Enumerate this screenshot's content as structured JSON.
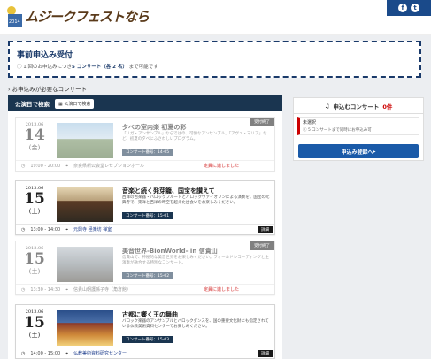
{
  "header": {
    "logo_text": "ムジークフェストなら",
    "logo_year": "2014"
  },
  "notice": {
    "title": "事前申込み受付",
    "prefix": "1 回のお申込みにつき",
    "bold": "5 コンサート（各 2 名）",
    "suffix": "まで可能です"
  },
  "section_label": "お申込みが必要なコンサート",
  "list": {
    "title": "公演日で検索",
    "search_btn": "公演日で検索"
  },
  "concerts": [
    {
      "year": "2013.06",
      "day": "14",
      "weekday": "(金)",
      "title": "夕べの室内楽 初夏の彩",
      "desc": "「リガ・アンサンブル」ならではの、可憐なアンサンブル。「アヴェ・マリア」など、初夏の夕べにふさわしいプログラム。",
      "tag": "コンサート番号：14-05",
      "time": "19:00 - 20:00",
      "venue": "奈良県新公会堂レセプションホール",
      "status": "受付終了",
      "end": "定員に達しました",
      "detail": ""
    },
    {
      "year": "2013.06",
      "day": "15",
      "weekday": "(土)",
      "title": "音楽と続く発芽籠、国宝を讃えて",
      "desc": "西洋の古楽器・バロックフルートとバロックヴァイオリンによる演奏を。国宝の元興寺で、東洋と西洋の時空を超えた出会いをお楽しみください。",
      "tag": "コンサート番号：15-01",
      "time": "13:00 - 14:00",
      "venue": "元興寺 極楽坊 禅室",
      "status": "",
      "end": "",
      "detail": "詳細"
    },
    {
      "year": "2013.06",
      "day": "15",
      "weekday": "(土)",
      "title": "美音世界-BionWorld- in 信貴山",
      "desc": "信貴山で、神秘的な美音世界をお楽しみください。フィールドレコーディングと生演奏が融合する特別なコンサート。",
      "tag": "コンサート番号：15-02",
      "time": "13:30 - 14:30",
      "venue": "信貴山朝護孫子寺（角倉館）",
      "status": "受付終了",
      "end": "定員に達しました",
      "detail": ""
    },
    {
      "year": "2013.06",
      "day": "15",
      "weekday": "(土)",
      "title": "古都に響く王の舞曲",
      "desc": "バロック楽器のアンサンブルとバロックダンスを、国の重要文化財にも指定されている仏教美術資料センターでお楽しみください。",
      "tag": "コンサート番号：15-03",
      "time": "14:00 - 15:00",
      "venue": "仏教美術資料研究センター",
      "status": "",
      "end": "",
      "detail": "詳細"
    }
  ],
  "cart": {
    "title": "申込むコンサート",
    "count": "0件",
    "none": "未選択",
    "hint": "5 コンサートまで同時にお申込み可",
    "register": "申込み登録へ"
  }
}
